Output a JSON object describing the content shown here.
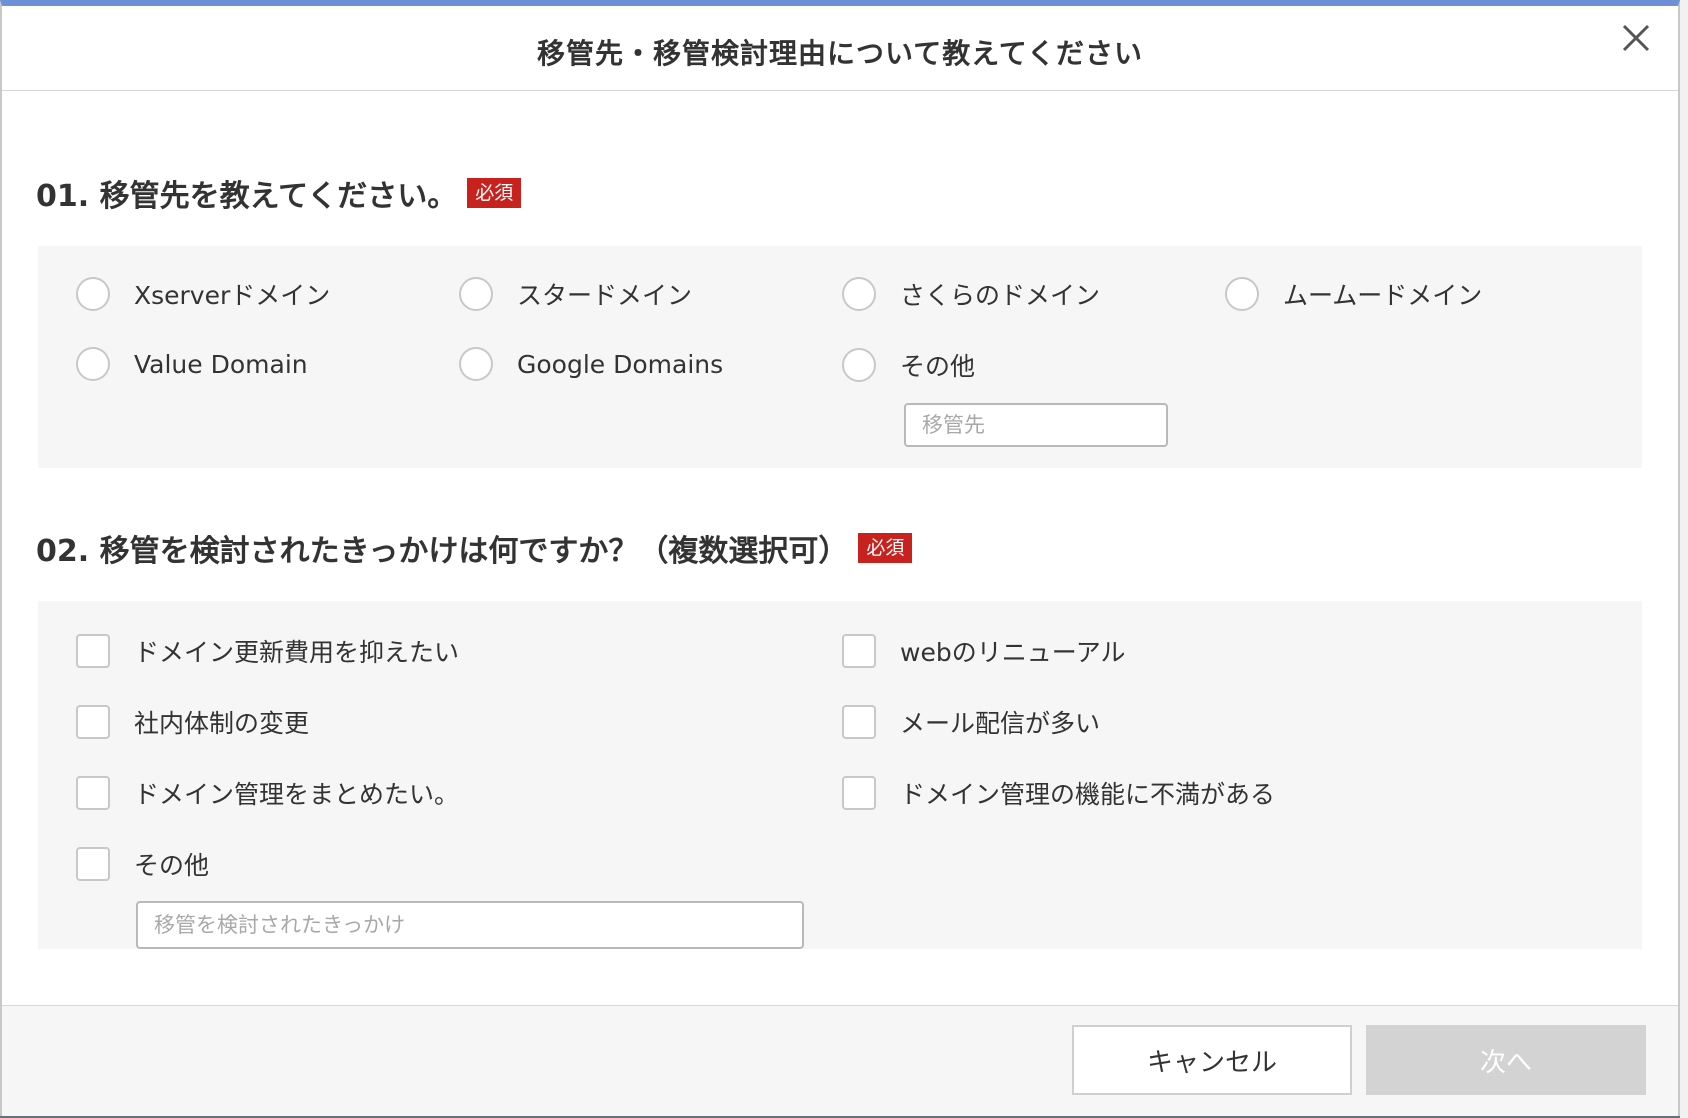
{
  "modal": {
    "title": "移管先・移管検討理由について教えてください"
  },
  "q1": {
    "title": "01. 移管先を教えてください。",
    "required": "必須",
    "options": [
      "Xserverドメイン",
      "スタードメイン",
      "さくらのドメイン",
      "ムームードメイン",
      "Value Domain",
      "Google Domains",
      "その他"
    ],
    "other_placeholder": "移管先"
  },
  "q2": {
    "title": "02. 移管を検討されたきっかけは何ですか？（複数選択可）",
    "required": "必須",
    "options": [
      "ドメイン更新費用を抑えたい",
      "webのリニューアル",
      "社内体制の変更",
      "メール配信が多い",
      "ドメイン管理をまとめたい。",
      "ドメイン管理の機能に不満がある",
      "その他"
    ],
    "other_placeholder": "移管を検討されたきっかけ"
  },
  "footer": {
    "cancel_label": "キャンセル",
    "next_label": "次へ"
  },
  "colors": {
    "required_badge": "#c8221e",
    "panel_bg": "#f6f6f6",
    "next_disabled": "#d3d3d3",
    "top_accent": "#6c8fd6"
  },
  "icons": {
    "close": "close-icon"
  }
}
